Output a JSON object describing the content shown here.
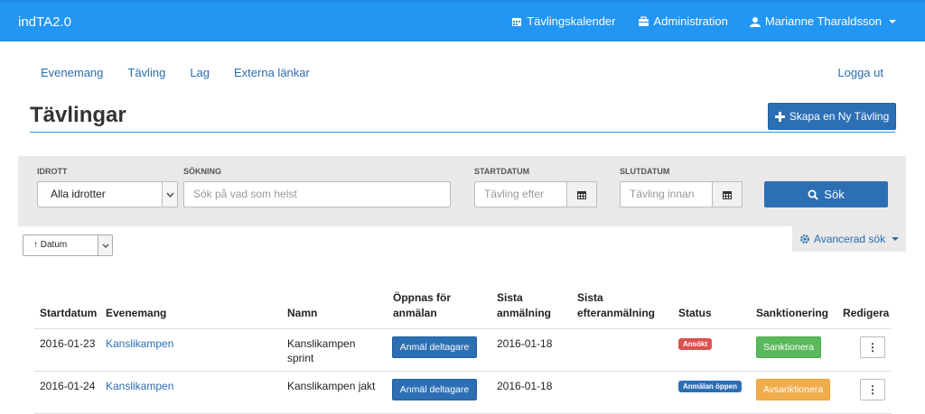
{
  "app": {
    "title": "indTA2.0",
    "topnav": {
      "calendar": "Tävlingskalender",
      "admin": "Administration",
      "user": "Marianne Tharaldsson"
    }
  },
  "subnav": {
    "items": [
      "Evenemang",
      "Tävling",
      "Lag",
      "Externa länkar"
    ],
    "logout": "Logga ut"
  },
  "page": {
    "title": "Tävlingar",
    "create_button": "Skapa en Ny Tävling"
  },
  "filters": {
    "sport_label": "IDROTT",
    "sport_value": "Alla idrotter",
    "search_label": "SÖKNING",
    "search_placeholder": "Sök på vad som helst",
    "start_label": "STARTDATUM",
    "start_placeholder": "Tävling efter",
    "end_label": "SLUTDATUM",
    "end_placeholder": "Tävling innan",
    "search_button": "Sök",
    "advanced": "Avancerad sök"
  },
  "sort": {
    "value": "↑ Datum"
  },
  "table": {
    "headers": {
      "start": "Startdatum",
      "event": "Evenemang",
      "name": "Namn",
      "opens_1": "Öppnas för",
      "opens_2": "anmälan",
      "last_1": "Sista",
      "last_2": "anmälning",
      "late_1": "Sista",
      "late_2": "efteranmälning",
      "status": "Status",
      "sanction": "Sanktionering",
      "edit": "Redigera"
    },
    "rows": [
      {
        "start": "2016-01-23",
        "event": "Kanslikampen",
        "name_1": "Kanslikampen",
        "name_2": "sprint",
        "register": "Anmäl deltagare",
        "last": "2016-01-18",
        "late": "",
        "status": "Ansökt",
        "sanction": "Sanktionera",
        "menu": "⋮"
      },
      {
        "start": "2016-01-24",
        "event": "Kanslikampen",
        "name_1": "Kanslikampen jakt",
        "name_2": "",
        "register": "Anmäl deltagare",
        "last": "2016-01-18",
        "late": "",
        "status": "Anmälan öppen",
        "sanction": "Avsanktionera",
        "menu": "⋮"
      }
    ]
  }
}
